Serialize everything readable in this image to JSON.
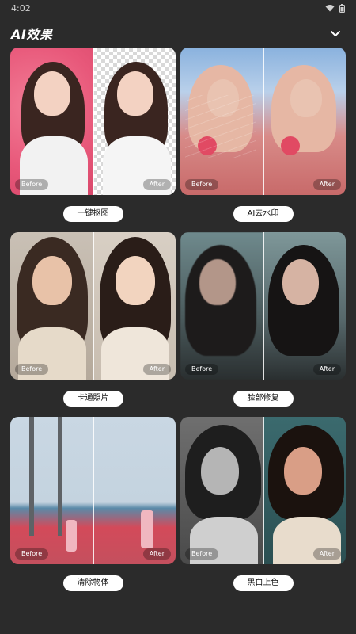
{
  "status": {
    "time": "4:02"
  },
  "header": {
    "title": "AI效果"
  },
  "tags": {
    "before": "Before",
    "after": "After"
  },
  "features": [
    {
      "id": "cutout",
      "label": "一键抠图"
    },
    {
      "id": "watermark",
      "label": "AI去水印"
    },
    {
      "id": "cartoon",
      "label": "卡通照片"
    },
    {
      "id": "face-repair",
      "label": "脸部修复"
    },
    {
      "id": "object-removal",
      "label": "清除物体"
    },
    {
      "id": "colorize",
      "label": "黑白上色"
    }
  ]
}
